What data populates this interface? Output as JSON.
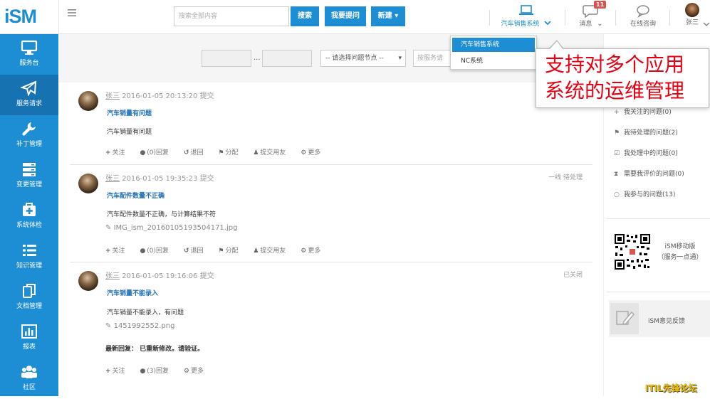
{
  "header": {
    "logo": "iSM",
    "search_placeholder": "搜索全部内容",
    "search_btn": "搜索",
    "ask_btn": "我要提问",
    "new_btn": "新建",
    "system_label": "汽车销售系统",
    "messages_label": "消息",
    "messages_count": "11",
    "consult_label": "在线咨询",
    "user_name": "张三"
  },
  "dropdown": {
    "items": [
      "汽车销售系统",
      "NC系统"
    ]
  },
  "callout": {
    "line1": "支持对多个应用",
    "line2": "系统的运维管理"
  },
  "sidebar": {
    "items": [
      {
        "label": "服务台",
        "icon": "monitor-icon"
      },
      {
        "label": "服务请求",
        "icon": "paper-plane-icon"
      },
      {
        "label": "补丁管理",
        "icon": "wrench-icon"
      },
      {
        "label": "变更管理",
        "icon": "server-icon"
      },
      {
        "label": "系统体检",
        "icon": "medkit-icon"
      },
      {
        "label": "知识管理",
        "icon": "list-icon"
      },
      {
        "label": "文档管理",
        "icon": "documents-icon"
      },
      {
        "label": "报表",
        "icon": "bar-chart-icon"
      },
      {
        "label": "社区",
        "icon": "group-icon"
      }
    ]
  },
  "filters": {
    "range_sep": "...",
    "node_select": "-- 请选择问题节点 --",
    "service_placeholder": "按服务请"
  },
  "posts": [
    {
      "user": "张三",
      "time": "2016-01-05 20:13:20 提交",
      "status": "",
      "title": "汽车销量有问题",
      "body": "汽车销量有问题",
      "attachment": "",
      "reply": ""
    },
    {
      "user": "张三",
      "time": "2016-01-05 19:35:23 提交",
      "status": "一线 待处理",
      "title": "汽车配件数量不正确",
      "body": "汽车配件数量不正确，与计算结果不符",
      "attachment": "IMG_ism_20160105193504171.jpg",
      "reply": ""
    },
    {
      "user": "张三",
      "time": "2016-01-05 19:16:06 提交",
      "status": "已关闭",
      "title": "汽车销量不能录入",
      "body": "汽车销量不能录入，有问题",
      "attachment": "1451992552.png",
      "reply": "最新回复： 已重新修改。请验证。"
    }
  ],
  "actions": {
    "follow": "关注",
    "reply0": "(0)回复",
    "reply3": "(3)回复",
    "undo": "退回",
    "assign": "分配",
    "submit_friend": "提交用友",
    "more": "更多"
  },
  "right_panel": {
    "items": [
      "我关注的问题(0)",
      "我待处理的问题(2)",
      "我处理中的问题(0)",
      "需要我评价的问题(0)",
      "我参与的问题(13)"
    ],
    "mobile_line1": "iSM移动版",
    "mobile_line2": "（服务一点通）",
    "feedback": "iSM意见反馈"
  },
  "watermark": "ITIL先锋论坛"
}
